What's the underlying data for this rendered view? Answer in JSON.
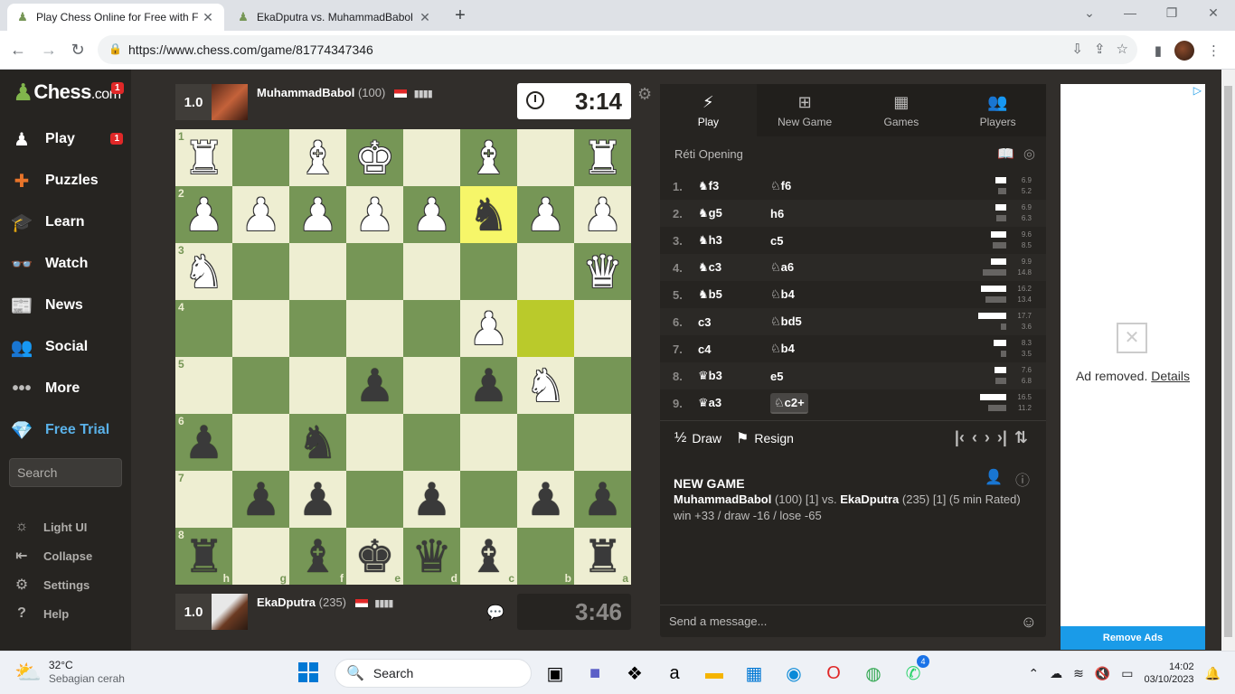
{
  "browser": {
    "tabs": [
      {
        "label": "Play Chess Online for Free with F",
        "active": true
      },
      {
        "label": "EkaDputra vs. MuhammadBabol",
        "active": false
      }
    ],
    "url": "https://www.chess.com/game/81774347346"
  },
  "sidebar": {
    "logo": {
      "main": "Chess",
      "suffix": ".com",
      "badge": "1"
    },
    "items": [
      {
        "label": "Play",
        "icon": "play-icon",
        "badge": "1"
      },
      {
        "label": "Puzzles",
        "icon": "puzzle-icon"
      },
      {
        "label": "Learn",
        "icon": "learn-icon"
      },
      {
        "label": "Watch",
        "icon": "binoculars-icon"
      },
      {
        "label": "News",
        "icon": "news-icon"
      },
      {
        "label": "Social",
        "icon": "social-icon"
      },
      {
        "label": "More",
        "icon": "more-icon"
      },
      {
        "label": "Free Trial",
        "icon": "diamond-icon"
      }
    ],
    "search_placeholder": "Search",
    "footer": [
      {
        "label": "Light UI",
        "icon": "sun-icon"
      },
      {
        "label": "Collapse",
        "icon": "collapse-icon"
      },
      {
        "label": "Settings",
        "icon": "gear-icon"
      },
      {
        "label": "Help",
        "icon": "help-icon"
      }
    ]
  },
  "game": {
    "top_player": {
      "score": "1.0",
      "name": "MuhammadBabol",
      "rating": "(100)",
      "clock": "3:14"
    },
    "bottom_player": {
      "score": "1.0",
      "name": "EkaDputra",
      "rating": "(235)",
      "clock": "3:46"
    }
  },
  "board": {
    "ranks": [
      "1",
      "2",
      "3",
      "4",
      "5",
      "6",
      "7",
      "8"
    ],
    "files": [
      "h",
      "g",
      "f",
      "e",
      "d",
      "c",
      "b",
      "a"
    ],
    "rows": [
      [
        "wR",
        "",
        "wB",
        "wK",
        "",
        "wB",
        "",
        "wR"
      ],
      [
        "wP",
        "wP",
        "wP",
        "wP",
        "wP",
        "bN",
        "wP",
        "wP"
      ],
      [
        "wN",
        "",
        "",
        "",
        "",
        "",
        "",
        "wQ"
      ],
      [
        "",
        "",
        "",
        "",
        "",
        "wP",
        "",
        ""
      ],
      [
        "",
        "",
        "",
        "bP",
        "",
        "bP",
        "wN",
        ""
      ],
      [
        "bP",
        "",
        "bN",
        "",
        "",
        "",
        "",
        ""
      ],
      [
        "",
        "bP",
        "bP",
        "",
        "bP",
        "",
        "bP",
        "bP"
      ],
      [
        "bR",
        "",
        "bB",
        "bK",
        "bQ",
        "bB",
        "",
        "bR"
      ]
    ],
    "highlights": [
      "1-5",
      "3-6"
    ]
  },
  "panel": {
    "tabs": [
      {
        "label": "Play",
        "icon": "lightning-icon"
      },
      {
        "label": "New Game",
        "icon": "plus-icon"
      },
      {
        "label": "Games",
        "icon": "games-icon"
      },
      {
        "label": "Players",
        "icon": "players-icon"
      }
    ],
    "opening": "Réti Opening",
    "moves": [
      {
        "num": "1.",
        "white": "f3",
        "white_piece": "♞",
        "black": "f6",
        "black_piece": "♘",
        "wt": "6.9",
        "bt": "5.2",
        "wf": 0.37,
        "bf": 0.28
      },
      {
        "num": "2.",
        "white": "g5",
        "white_piece": "♞",
        "black": "h6",
        "black_piece": "",
        "wt": "6.9",
        "bt": "6.3",
        "wf": 0.37,
        "bf": 0.34
      },
      {
        "num": "3.",
        "white": "h3",
        "white_piece": "♞",
        "black": "c5",
        "black_piece": "",
        "wt": "9.6",
        "bt": "8.5",
        "wf": 0.52,
        "bf": 0.46
      },
      {
        "num": "4.",
        "white": "c3",
        "white_piece": "♞",
        "black": "a6",
        "black_piece": "♘",
        "wt": "9.9",
        "bt": "14.8",
        "wf": 0.54,
        "bf": 0.8
      },
      {
        "num": "5.",
        "white": "b5",
        "white_piece": "♞",
        "black": "b4",
        "black_piece": "♘",
        "wt": "16.2",
        "bt": "13.4",
        "wf": 0.88,
        "bf": 0.73
      },
      {
        "num": "6.",
        "white": "c3",
        "white_piece": "",
        "black": "bd5",
        "black_piece": "♘",
        "wt": "17.7",
        "bt": "3.6",
        "wf": 0.96,
        "bf": 0.2
      },
      {
        "num": "7.",
        "white": "c4",
        "white_piece": "",
        "black": "b4",
        "black_piece": "♘",
        "wt": "8.3",
        "bt": "3.5",
        "wf": 0.45,
        "bf": 0.19
      },
      {
        "num": "8.",
        "white": "b3",
        "white_piece": "♛",
        "black": "e5",
        "black_piece": "",
        "wt": "7.6",
        "bt": "6.8",
        "wf": 0.41,
        "bf": 0.37
      },
      {
        "num": "9.",
        "white": "a3",
        "white_piece": "♛",
        "black": "c2+",
        "black_piece": "♘",
        "wt": "16.5",
        "bt": "11.2",
        "wf": 0.9,
        "bf": 0.61
      }
    ],
    "draw_label": "Draw",
    "draw_icon": "½",
    "resign_label": "Resign",
    "new_game": {
      "title": "NEW GAME",
      "white_name": "MuhammadBabol",
      "white_info": "(100) [1] vs.",
      "black_name": "EkaDputra",
      "black_info": "(235) [1] (5 min Rated)",
      "result": "win +33 / draw -16 / lose -65"
    },
    "chat_placeholder": "Send a message..."
  },
  "ad": {
    "removed": "Ad removed.",
    "details": "Details",
    "remove_ads": "Remove Ads"
  },
  "taskbar": {
    "temp": "32°C",
    "weather": "Sebagian cerah",
    "search": "Search",
    "time": "14:02",
    "date": "03/10/2023",
    "whatsapp_badge": "4"
  }
}
